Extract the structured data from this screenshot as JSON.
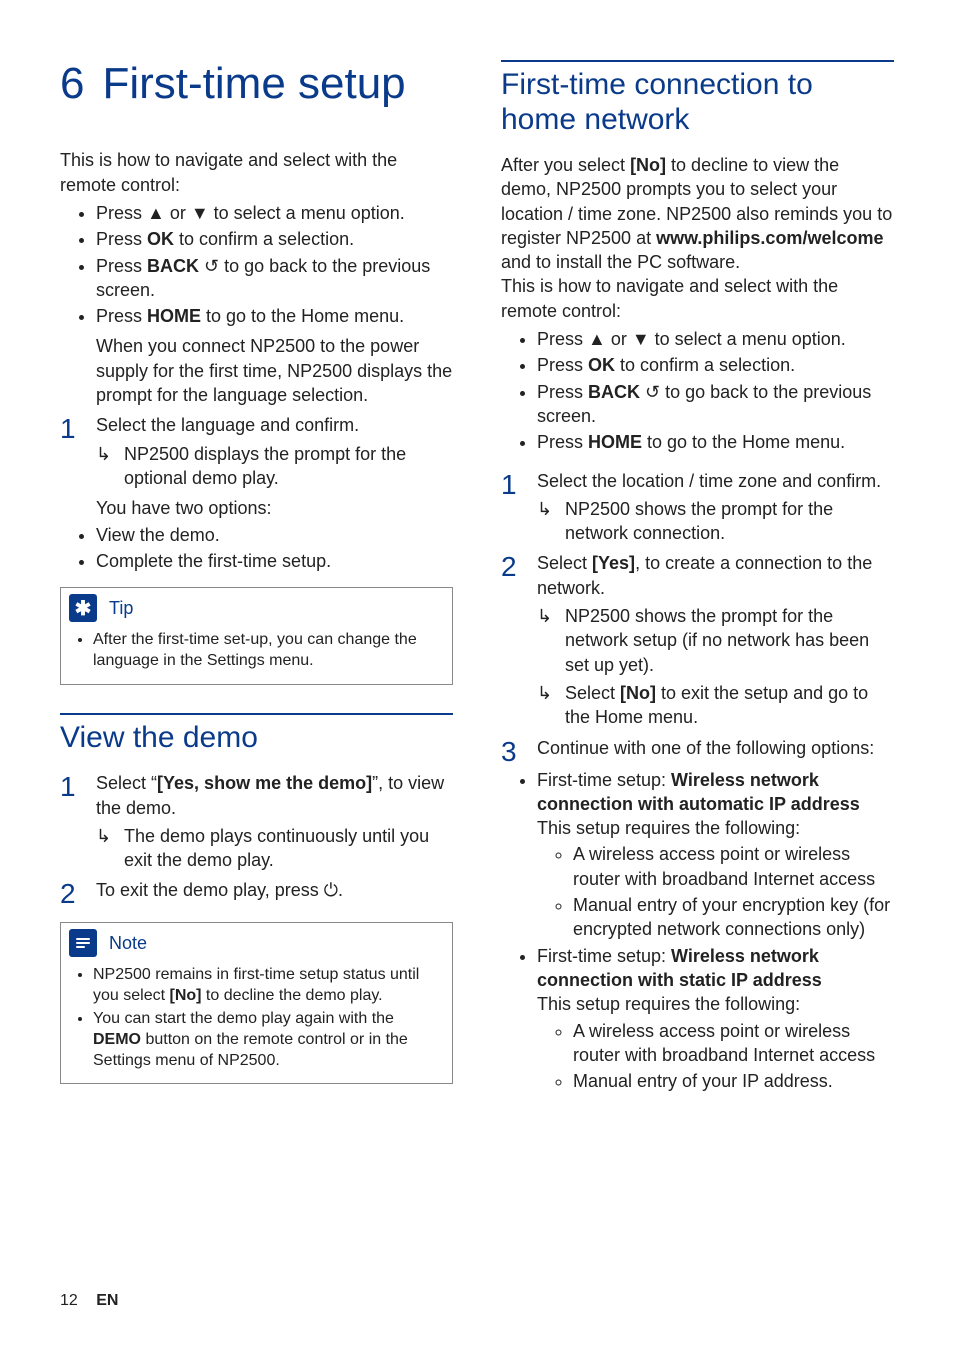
{
  "chapter": {
    "number": "6",
    "title": "First-time setup"
  },
  "left": {
    "intro": "This is how to navigate and select with the remote control:",
    "nav": [
      "Press ▲ or ▼ to select a menu option.",
      "Press <b>OK</b> to confirm a selection.",
      "Press <b>BACK</b> <span class='glyph'>↺</span> to go back to the previous screen.",
      "Press <b>HOME</b> to go to the Home menu."
    ],
    "connectPara": "When you connect NP2500 to the power supply for the first time, NP2500 displays the prompt for the language selection.",
    "step1": {
      "num": "1",
      "text": "Select the language and confirm.",
      "arrow": "NP2500 displays the prompt for the optional demo play.",
      "after": "You have two options:"
    },
    "options": [
      "View the demo.",
      "Complete the first-time setup."
    ],
    "tip": {
      "label": "Tip",
      "items": [
        "After the first-time set-up, you can change the language in the Settings menu."
      ]
    },
    "section2": {
      "title": "View the demo",
      "step1": {
        "num": "1",
        "text": "Select “<b>[Yes, show me the demo]</b>”, to view the demo.",
        "arrow": "The demo plays continuously until you exit the demo play."
      },
      "step2": {
        "num": "2",
        "text": "To exit the demo play, press <span class='glyph'>⏻</span>."
      },
      "note": {
        "label": "Note",
        "items": [
          "NP2500 remains in first-time setup status until you select <b>[No]</b> to decline the demo play.",
          "You can start the demo play again with the <b>DEMO</b> button on the remote control or in the Settings menu of NP2500."
        ]
      }
    }
  },
  "right": {
    "title": "First-time connection to home network",
    "para": "After you select <b>[No]</b> to decline to view the demo, NP2500 prompts you to select your location / time zone. NP2500 also reminds you to register NP2500 at <b>www.philips.com/welcome</b> and to install the PC software.<br>This is how to navigate and select with the remote control:",
    "nav": [
      "Press ▲ or ▼ to select a menu option.",
      "Press <b>OK</b> to confirm a selection.",
      "Press <b>BACK</b> <span class='glyph'>↺</span> to go back to the previous screen.",
      "Press <b>HOME</b> to go to the Home menu."
    ],
    "step1": {
      "num": "1",
      "text": "Select the location / time zone and confirm.",
      "arrow": "NP2500 shows the prompt for the network connection."
    },
    "step2": {
      "num": "2",
      "text": "Select <b>[Yes]</b>, to create a connection to the network.",
      "arrow1": "NP2500 shows the prompt for the network setup (if no network has been set up yet).",
      "arrow2": "Select <b>[No]</b> to exit the setup and go to the Home menu."
    },
    "step3": {
      "num": "3",
      "text": "Continue with one of the following options:"
    },
    "opts": [
      {
        "lead": "First-time setup: <b>Wireless network connection with automatic IP address</b>",
        "req": "This setup requires the following:",
        "items": [
          "A wireless access point or wireless router with broadband Internet access",
          "Manual entry of your encryption key (for encrypted network connections only)"
        ]
      },
      {
        "lead": "First-time setup: <b>Wireless network connection with static IP address</b>",
        "req": "This setup requires the following:",
        "items": [
          "A wireless access point or wireless router with broadband Internet access",
          "Manual entry of your IP address."
        ]
      }
    ]
  },
  "footer": {
    "page": "12",
    "lang": "EN"
  }
}
